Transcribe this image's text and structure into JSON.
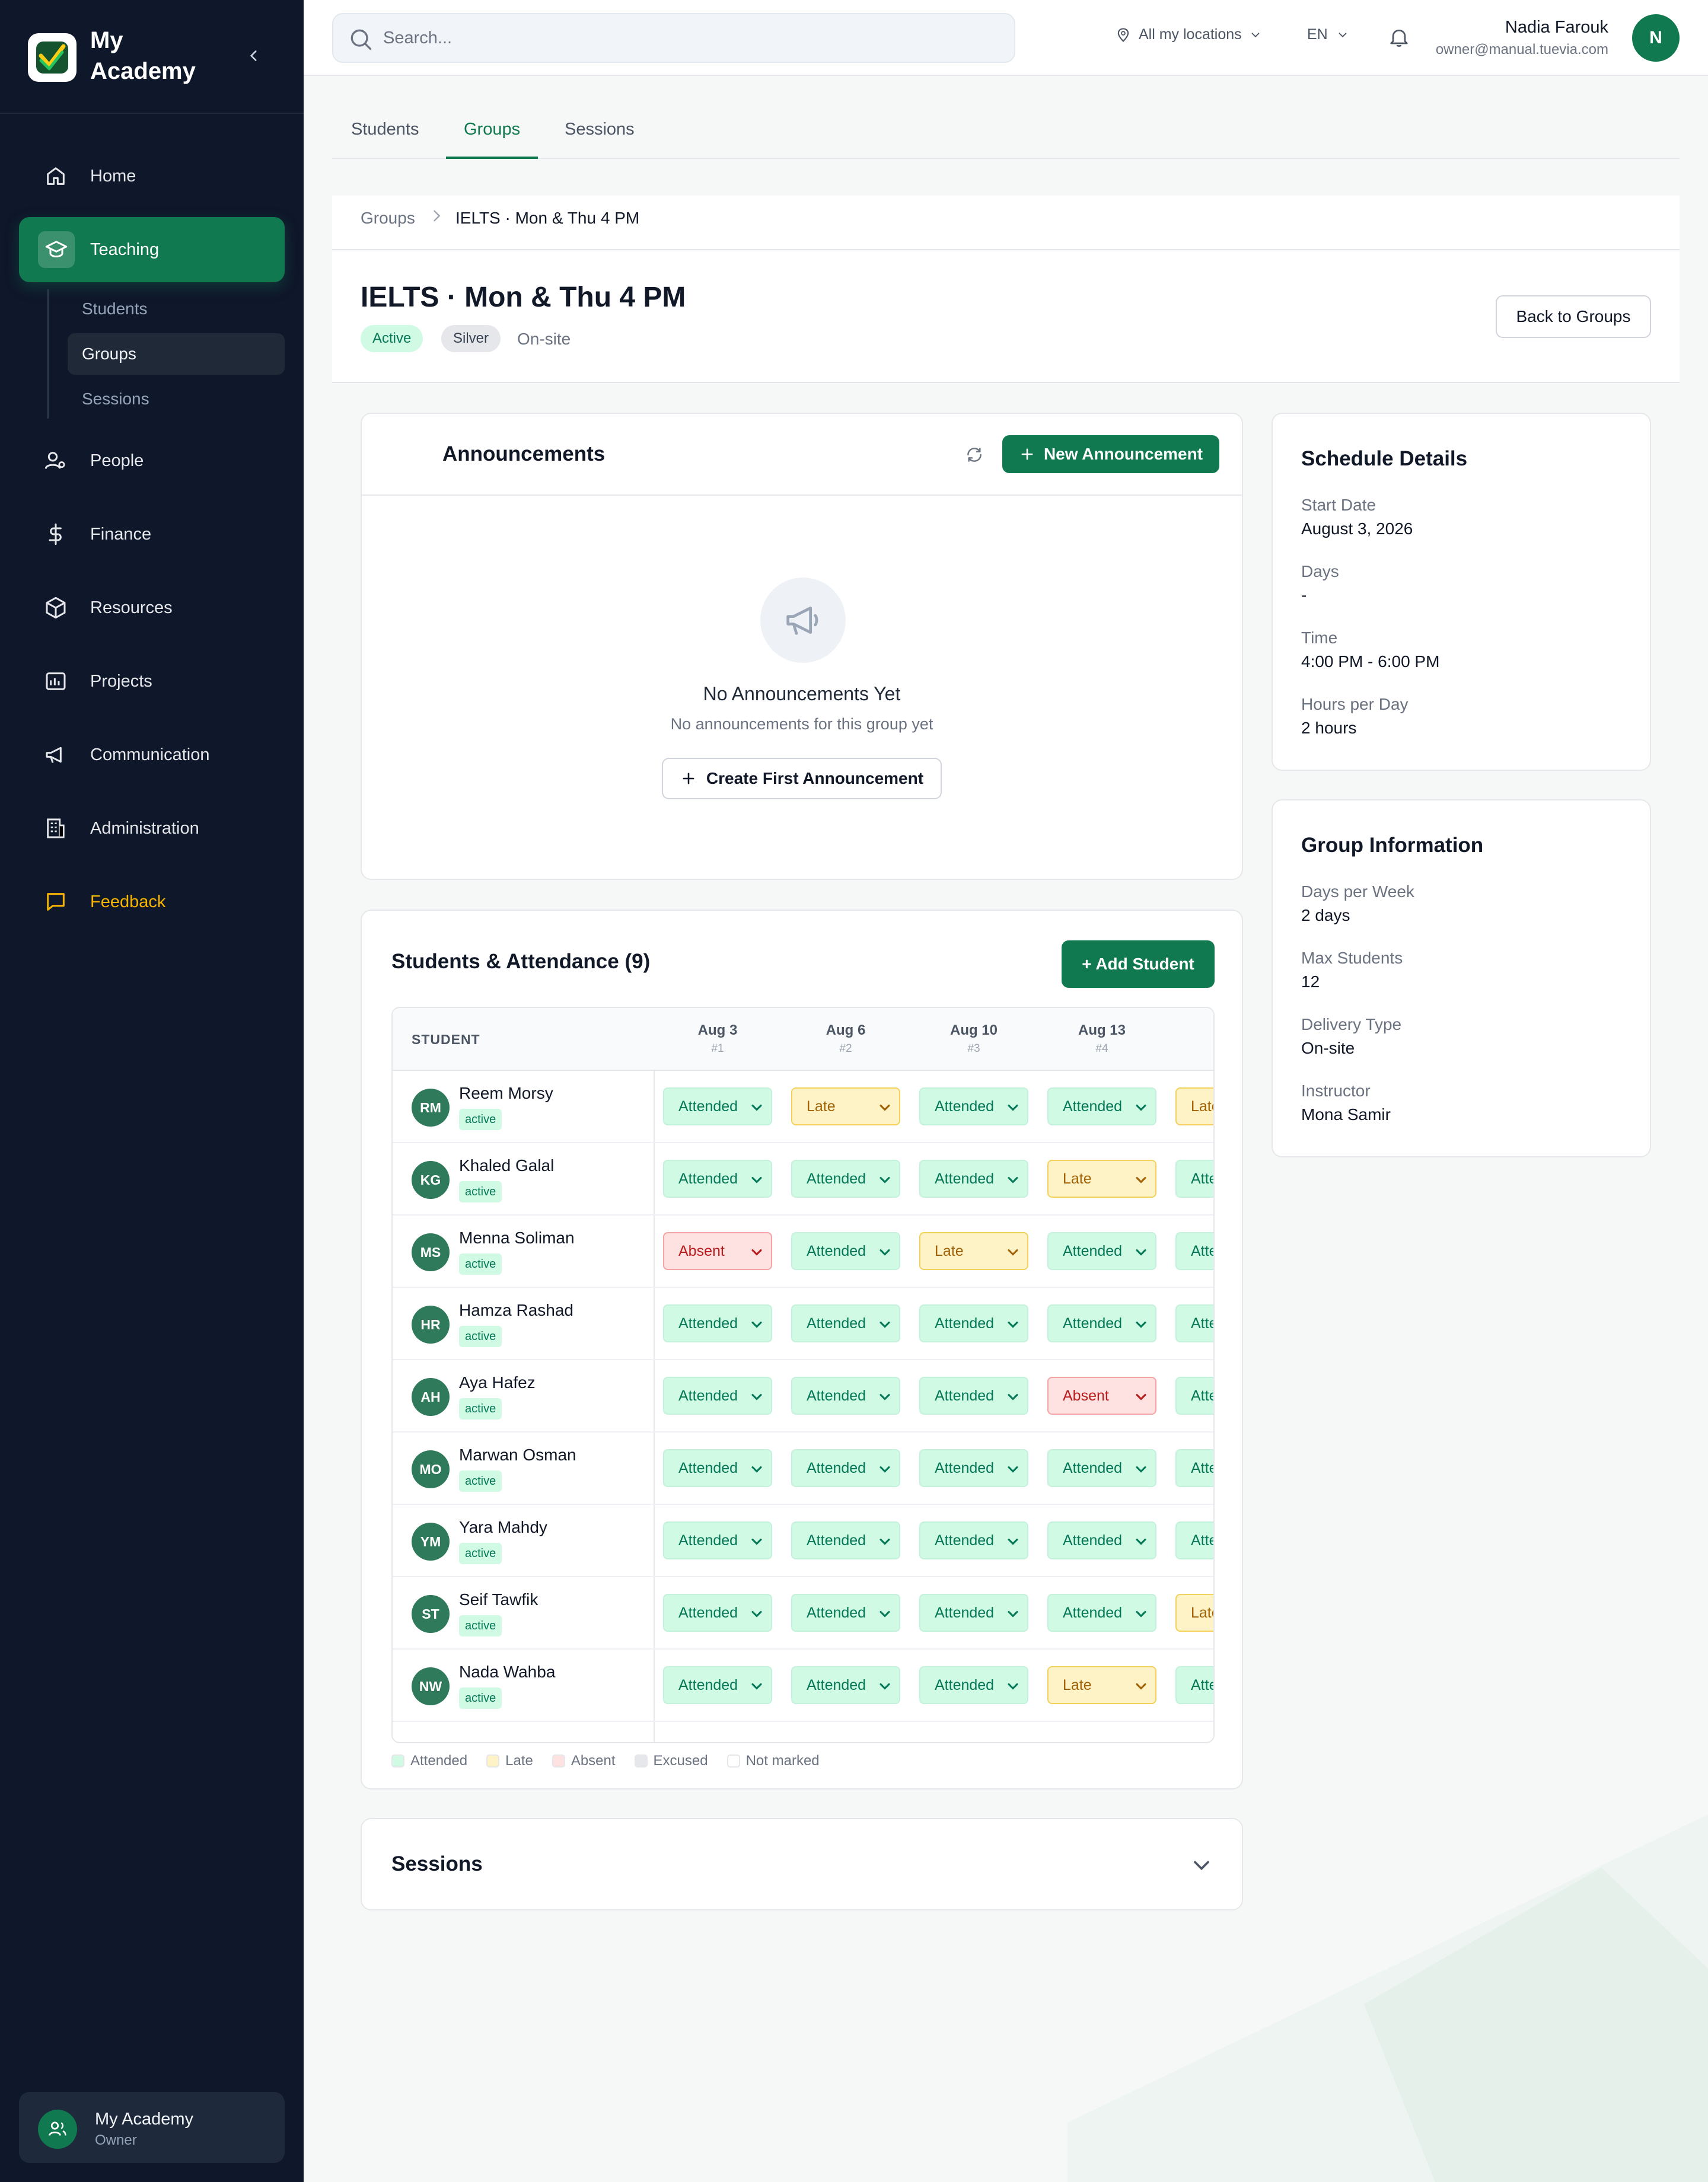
{
  "brand": {
    "name": "My Academy",
    "logo_icon": "academy-logo-icon"
  },
  "colors": {
    "primary": "#10794f",
    "sidebar": "#0f172a",
    "feedback": "#f5b400",
    "attended": "#d1fae5",
    "late": "#fef3c7",
    "absent": "#fee2e2"
  },
  "sidebar": {
    "items": [
      {
        "label": "Home",
        "icon": "home-icon"
      },
      {
        "label": "Teaching",
        "icon": "graduation-cap-icon"
      },
      {
        "label": "People",
        "icon": "people-icon"
      },
      {
        "label": "Finance",
        "icon": "dollar-icon"
      },
      {
        "label": "Resources",
        "icon": "box-icon"
      },
      {
        "label": "Projects",
        "icon": "projects-icon"
      },
      {
        "label": "Communication",
        "icon": "megaphone-icon"
      },
      {
        "label": "Administration",
        "icon": "building-icon"
      },
      {
        "label": "Feedback",
        "icon": "message-icon"
      }
    ],
    "teaching_sub": [
      "Students",
      "Groups",
      "Sessions"
    ],
    "account": {
      "name": "My Academy",
      "role": "Owner"
    }
  },
  "topbar": {
    "search_placeholder": "Search...",
    "location": "All my locations",
    "language": "EN",
    "user_name": "Nadia Farouk",
    "user_email": "owner@manual.tuevia.com",
    "user_initial": "N"
  },
  "tabs": [
    "Students",
    "Groups",
    "Sessions"
  ],
  "breadcrumb": {
    "parent": "Groups",
    "current": "IELTS · Mon & Thu 4 PM"
  },
  "group": {
    "title": "IELTS · Mon & Thu 4 PM",
    "status": "Active",
    "tier": "Silver",
    "delivery": "On-site",
    "back_label": "Back to Groups"
  },
  "announcements": {
    "title": "Announcements",
    "new_label": "New Announcement",
    "empty_title": "No Announcements Yet",
    "empty_sub": "No announcements for this group yet",
    "create_first_label": "Create First Announcement"
  },
  "attendance": {
    "title": "Students & Attendance (9)",
    "add_label": "+ Add Student",
    "student_header": "STUDENT",
    "dates": [
      {
        "date": "Aug 3",
        "num": "#1"
      },
      {
        "date": "Aug 6",
        "num": "#2"
      },
      {
        "date": "Aug 10",
        "num": "#3"
      },
      {
        "date": "Aug 13",
        "num": "#4"
      },
      {
        "date": "A",
        "num": ""
      }
    ],
    "students": [
      {
        "initials": "RM",
        "name": "Reem Morsy",
        "status": "active",
        "marks": [
          "Attended",
          "Late",
          "Attended",
          "Attended",
          "Late"
        ]
      },
      {
        "initials": "KG",
        "name": "Khaled Galal",
        "status": "active",
        "marks": [
          "Attended",
          "Attended",
          "Attended",
          "Late",
          "Attended"
        ]
      },
      {
        "initials": "MS",
        "name": "Menna Soliman",
        "status": "active",
        "marks": [
          "Absent",
          "Attended",
          "Late",
          "Attended",
          "Attended"
        ]
      },
      {
        "initials": "HR",
        "name": "Hamza Rashad",
        "status": "active",
        "marks": [
          "Attended",
          "Attended",
          "Attended",
          "Attended",
          "Attended"
        ]
      },
      {
        "initials": "AH",
        "name": "Aya Hafez",
        "status": "active",
        "marks": [
          "Attended",
          "Attended",
          "Attended",
          "Absent",
          "Attended"
        ]
      },
      {
        "initials": "MO",
        "name": "Marwan Osman",
        "status": "active",
        "marks": [
          "Attended",
          "Attended",
          "Attended",
          "Attended",
          "Attended"
        ]
      },
      {
        "initials": "YM",
        "name": "Yara Mahdy",
        "status": "active",
        "marks": [
          "Attended",
          "Attended",
          "Attended",
          "Attended",
          "Attended"
        ]
      },
      {
        "initials": "ST",
        "name": "Seif Tawfik",
        "status": "active",
        "marks": [
          "Attended",
          "Attended",
          "Attended",
          "Attended",
          "Late"
        ]
      },
      {
        "initials": "NW",
        "name": "Nada Wahba",
        "status": "active",
        "marks": [
          "Attended",
          "Attended",
          "Attended",
          "Late",
          "Attended"
        ]
      }
    ],
    "legend": [
      {
        "label": "Attended",
        "color": "#d1fae5"
      },
      {
        "label": "Late",
        "color": "#fef3c7"
      },
      {
        "label": "Absent",
        "color": "#fee2e2"
      },
      {
        "label": "Excused",
        "color": "#e5e7eb"
      },
      {
        "label": "Not marked",
        "color": "#ffffff"
      }
    ]
  },
  "sessions": {
    "title": "Sessions"
  },
  "schedule": {
    "title": "Schedule Details",
    "fields": [
      {
        "label": "Start Date",
        "value": "August 3, 2026"
      },
      {
        "label": "Days",
        "value": "-"
      },
      {
        "label": "Time",
        "value": "4:00 PM - 6:00 PM"
      },
      {
        "label": "Hours per Day",
        "value": "2 hours"
      }
    ]
  },
  "group_info": {
    "title": "Group Information",
    "fields": [
      {
        "label": "Days per Week",
        "value": "2 days"
      },
      {
        "label": "Max Students",
        "value": "12"
      },
      {
        "label": "Delivery Type",
        "value": "On-site"
      },
      {
        "label": "Instructor",
        "value": "Mona Samir"
      }
    ]
  }
}
